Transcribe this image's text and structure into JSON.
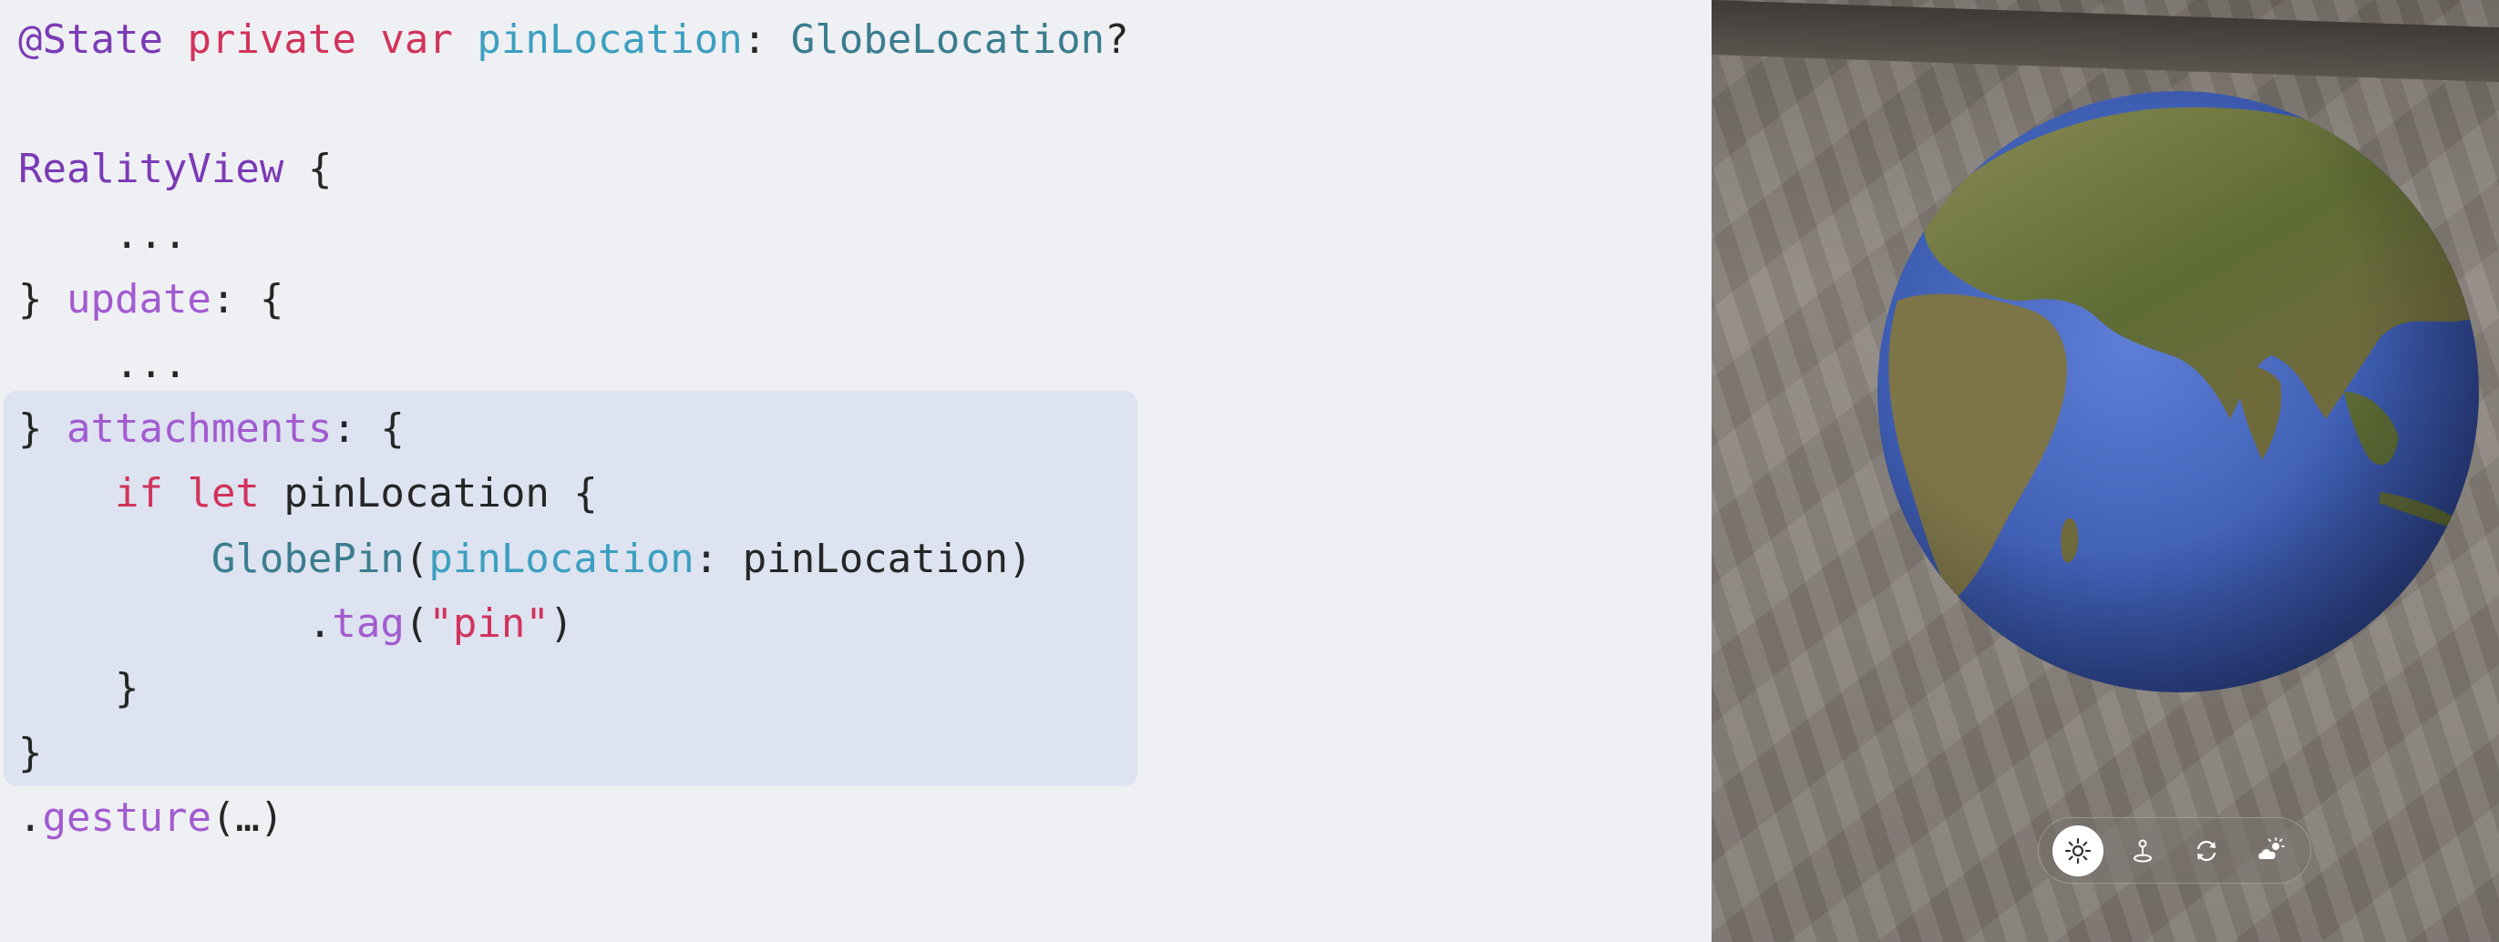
{
  "code": {
    "lines": [
      [
        {
          "t": "@State",
          "c": "attr"
        },
        {
          "t": " ",
          "c": "plain"
        },
        {
          "t": "private",
          "c": "kw"
        },
        {
          "t": " ",
          "c": "plain"
        },
        {
          "t": "var",
          "c": "kw"
        },
        {
          "t": " ",
          "c": "plain"
        },
        {
          "t": "pinLocation",
          "c": "prop"
        },
        {
          "t": ": ",
          "c": "plain"
        },
        {
          "t": "GlobeLocation",
          "c": "type"
        },
        {
          "t": "?",
          "c": "plain"
        }
      ],
      [],
      [
        {
          "t": "RealityView",
          "c": "attr"
        },
        {
          "t": " {",
          "c": "plain"
        }
      ],
      [
        {
          "t": "    ...",
          "c": "plain"
        }
      ],
      [
        {
          "t": "} ",
          "c": "plain"
        },
        {
          "t": "update",
          "c": "fn"
        },
        {
          "t": ": {",
          "c": "plain"
        }
      ],
      [
        {
          "t": "    ...",
          "c": "plain"
        }
      ],
      [
        {
          "t": "} ",
          "c": "plain"
        },
        {
          "t": "attachments",
          "c": "fn"
        },
        {
          "t": ": {",
          "c": "plain"
        }
      ],
      [
        {
          "t": "    ",
          "c": "plain"
        },
        {
          "t": "if",
          "c": "kw"
        },
        {
          "t": " ",
          "c": "plain"
        },
        {
          "t": "let",
          "c": "kw"
        },
        {
          "t": " pinLocation {",
          "c": "plain"
        }
      ],
      [
        {
          "t": "        ",
          "c": "plain"
        },
        {
          "t": "GlobePin",
          "c": "type"
        },
        {
          "t": "(",
          "c": "plain"
        },
        {
          "t": "pinLocation",
          "c": "prop"
        },
        {
          "t": ": pinLocation)",
          "c": "plain"
        }
      ],
      [
        {
          "t": "            .",
          "c": "plain"
        },
        {
          "t": "tag",
          "c": "fn"
        },
        {
          "t": "(",
          "c": "plain"
        },
        {
          "t": "\"pin\"",
          "c": "str"
        },
        {
          "t": ")",
          "c": "plain"
        }
      ],
      [
        {
          "t": "    }",
          "c": "plain"
        }
      ],
      [
        {
          "t": "}",
          "c": "plain"
        }
      ],
      [
        {
          "t": ".",
          "c": "plain"
        },
        {
          "t": "gesture",
          "c": "fn"
        },
        {
          "t": "(…)",
          "c": "plain"
        }
      ]
    ]
  },
  "colors": {
    "highlight": "#dde3f0",
    "ocean": "#3f5fb5",
    "land": "#6c7a3c",
    "toolbar_active": "#ffffff"
  },
  "toolbar": {
    "buttons": [
      {
        "icon": "sun-icon",
        "active": true
      },
      {
        "icon": "pin-drop-icon",
        "active": false
      },
      {
        "icon": "rotate-icon",
        "active": false
      },
      {
        "icon": "cloud-sun-icon",
        "active": false
      }
    ]
  }
}
